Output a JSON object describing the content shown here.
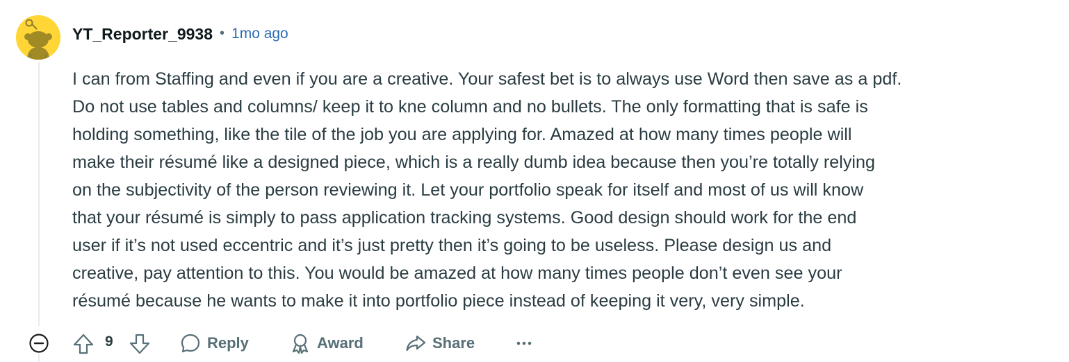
{
  "comment": {
    "author": "YT_Reporter_9938",
    "separator": "•",
    "timestamp": "1mo ago",
    "body": "I can from Staffing and even if you are a creative. Your safest bet is to always use Word then save as a pdf.\nDo not use tables and columns/ keep it to kne column and no bullets. The only formatting that is safe is\nholding something, like the tile of the job you are applying for. Amazed at how many times people will\nmake their résumé like a designed piece, which is a really dumb idea because then you’re totally relying\non the subjectivity of the person reviewing it. Let your portfolio speak for itself and most of us will know\nthat your résumé is simply to pass application tracking systems. Good design should work for the end\nuser if it’s not used eccentric and it’s just pretty then it’s going to be useless. Please design us and\ncreative, pay attention to this. You would be amazed at how many times people don’t even see your\nrésumé because he wants to make it into portfolio piece instead of keeping it very, very simple."
  },
  "actions": {
    "score": "9",
    "reply_label": "Reply",
    "award_label": "Award",
    "share_label": "Share"
  },
  "icons": {
    "avatar": "snoo-avatar",
    "collapse": "collapse-minus-icon",
    "upvote": "upvote-arrow-icon",
    "downvote": "downvote-arrow-icon",
    "reply": "speech-bubble-icon",
    "award": "award-ribbon-icon",
    "share": "share-arrow-icon",
    "more": "ellipsis-icon"
  },
  "colors": {
    "avatar_background": "#ffd635",
    "timestamp": "#2a6bb3",
    "action_text": "#576f76",
    "body_text": "#2a3c42",
    "thread_line": "#e5ebee"
  }
}
